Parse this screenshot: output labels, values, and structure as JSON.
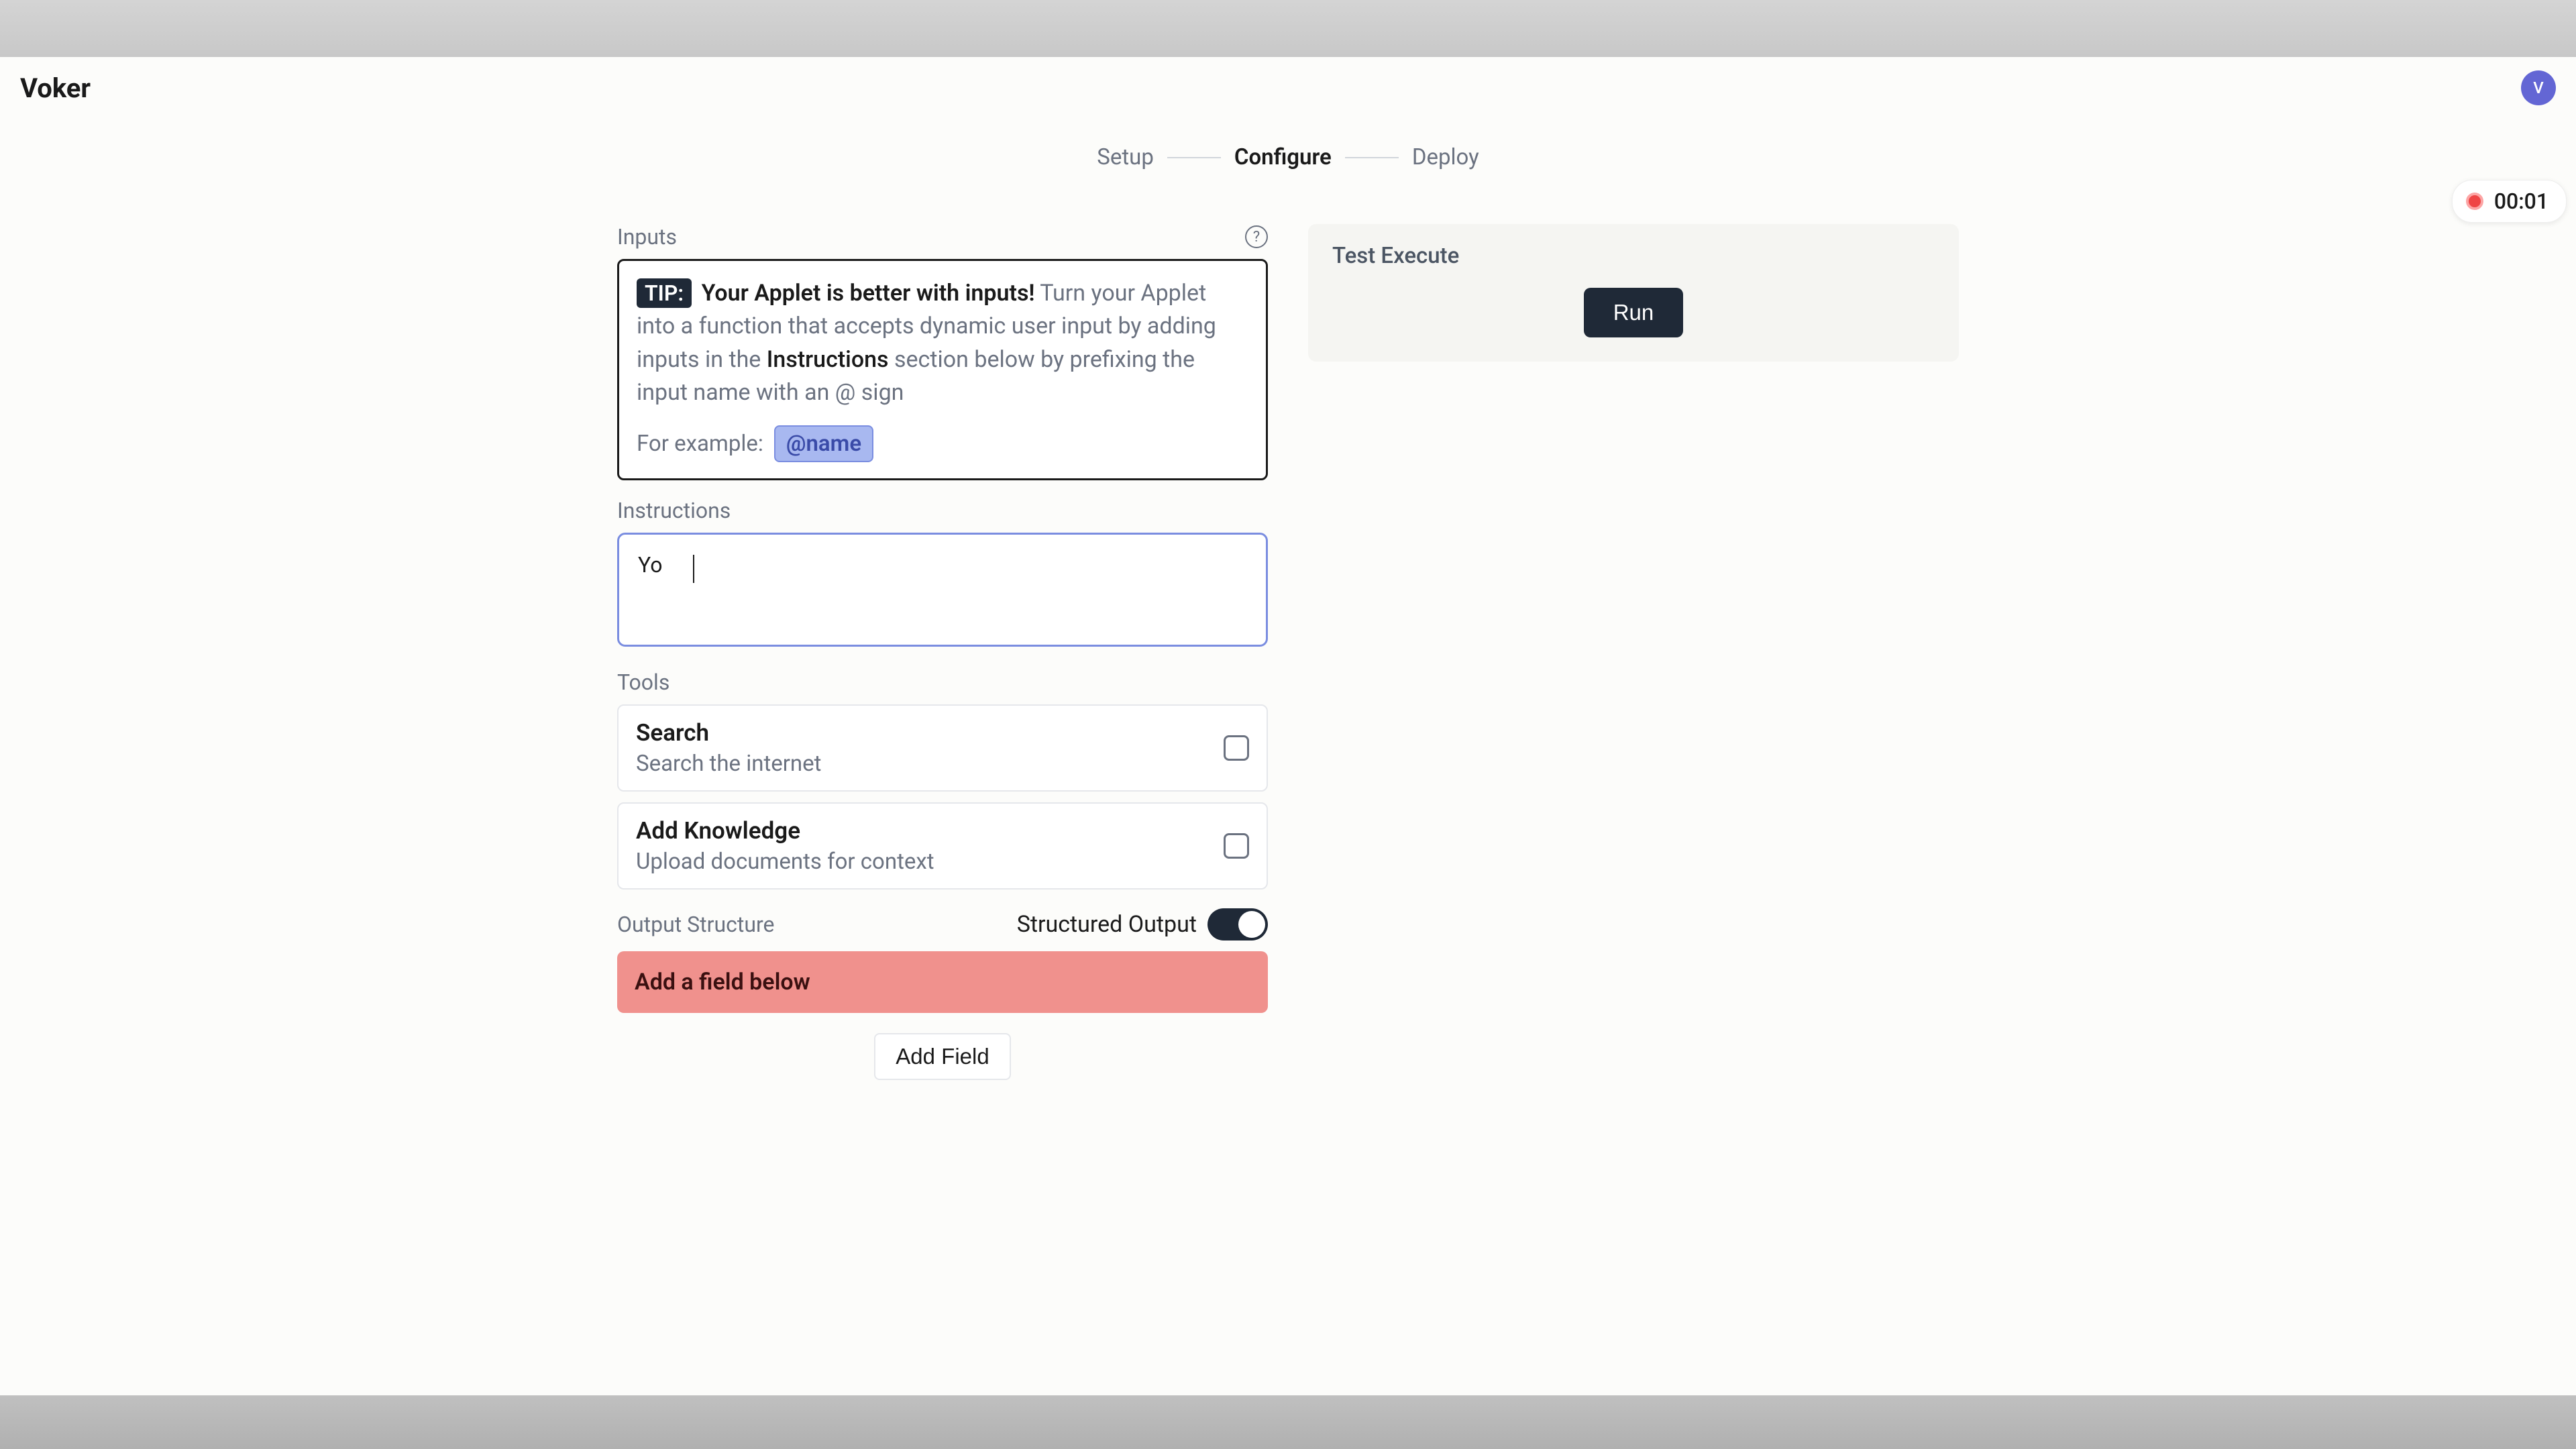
{
  "app": {
    "name": "Voker",
    "avatar_initial": "V"
  },
  "stepper": {
    "step1": "Setup",
    "step2": "Configure",
    "step3": "Deploy"
  },
  "inputs": {
    "label": "Inputs",
    "tip_badge": "TIP:",
    "tip_strong": "Your Applet is better with inputs!",
    "tip_rest1": " Turn your Applet into a function that accepts dynamic user input by adding inputs in the ",
    "tip_instructions_word": "Instructions",
    "tip_rest2": " section below by prefixing the input name with an @ sign",
    "example_label": "For example:",
    "example_token": "@name"
  },
  "instructions": {
    "label": "Instructions",
    "value": "Yo"
  },
  "tools": {
    "label": "Tools",
    "items": [
      {
        "title": "Search",
        "desc": "Search the internet"
      },
      {
        "title": "Add Knowledge",
        "desc": "Upload documents for context"
      }
    ]
  },
  "output": {
    "label": "Output Structure",
    "toggle_label": "Structured Output",
    "warning": "Add a field below",
    "add_button": "Add Field"
  },
  "test": {
    "title": "Test Execute",
    "run": "Run"
  },
  "recording": {
    "time": "00:01"
  }
}
